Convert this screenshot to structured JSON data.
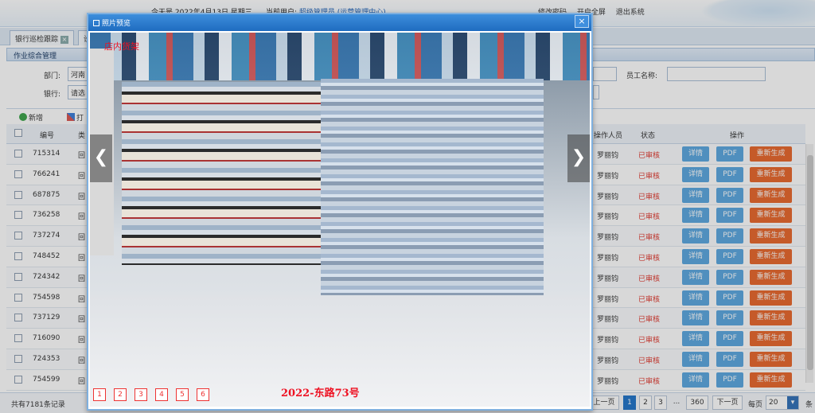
{
  "header": {
    "date_text": "今天是 2022年4月13日 星期三",
    "user_label": "当前用户:",
    "user_name": "超级管理员",
    "user_center": "(运营管理中心)",
    "actions": [
      "修改密码",
      "开启全屏",
      "退出系统"
    ]
  },
  "tabs": [
    {
      "label": "银行巡检跟踪"
    },
    {
      "label": "设"
    }
  ],
  "panel": {
    "title": "作业综合管理",
    "dept_label": "部门:",
    "dept_value": "河南",
    "bank_label": "银行:",
    "bank_value": "请选",
    "employee_label": "员工名称:"
  },
  "toolbar": {
    "add": "新增",
    "print": "打"
  },
  "table": {
    "headers": {
      "no": "编号",
      "type": "类",
      "operator": "操作人员",
      "status": "状态",
      "action": "操作"
    },
    "rows": [
      {
        "no": "715314",
        "type": "回",
        "operator": "罗丽钧",
        "status": "已审核"
      },
      {
        "no": "766241",
        "type": "回",
        "operator": "罗丽钧",
        "status": "已审核"
      },
      {
        "no": "687875",
        "type": "回",
        "operator": "罗丽钧",
        "status": "已审核"
      },
      {
        "no": "736258",
        "type": "回",
        "operator": "罗丽钧",
        "status": "已审核"
      },
      {
        "no": "737274",
        "type": "回",
        "operator": "罗丽钧",
        "status": "已审核"
      },
      {
        "no": "748452",
        "type": "回",
        "operator": "罗丽钧",
        "status": "已审核"
      },
      {
        "no": "724342",
        "type": "回",
        "operator": "罗丽钧",
        "status": "已审核"
      },
      {
        "no": "754598",
        "type": "回",
        "operator": "罗丽钧",
        "status": "已审核"
      },
      {
        "no": "737129",
        "type": "回",
        "operator": "罗丽钧",
        "status": "已审核"
      },
      {
        "no": "716090",
        "type": "回",
        "operator": "罗丽钧",
        "status": "已审核"
      },
      {
        "no": "724353",
        "type": "回",
        "operator": "罗丽钧",
        "status": "已审核"
      },
      {
        "no": "754599",
        "type": "回",
        "operator": "罗丽钧",
        "status": "已审核"
      }
    ],
    "btn_detail": "详情",
    "btn_pdf": "PDF",
    "btn_regen": "重新生成"
  },
  "footer": {
    "total": "共有7181条记录",
    "prev": "上一页",
    "pages": [
      "1",
      "2",
      "3"
    ],
    "ellipsis": "...",
    "last": "360",
    "next": "下一页",
    "per_page_label": "每页",
    "per_page": "20",
    "tail": "条"
  },
  "modal": {
    "title": "照片预览",
    "close": "×",
    "caption": "店内货架",
    "watermark": "2022-东路73号",
    "prev_arrow": "❮",
    "next_arrow": "❯",
    "thumbs": [
      "1",
      "2",
      "3",
      "4",
      "5",
      "6"
    ]
  },
  "colors": {
    "accent": "#1f6cc0",
    "status": "#e0352b",
    "btn_blue": "#5aa6e0",
    "btn_orange": "#e8662a"
  }
}
